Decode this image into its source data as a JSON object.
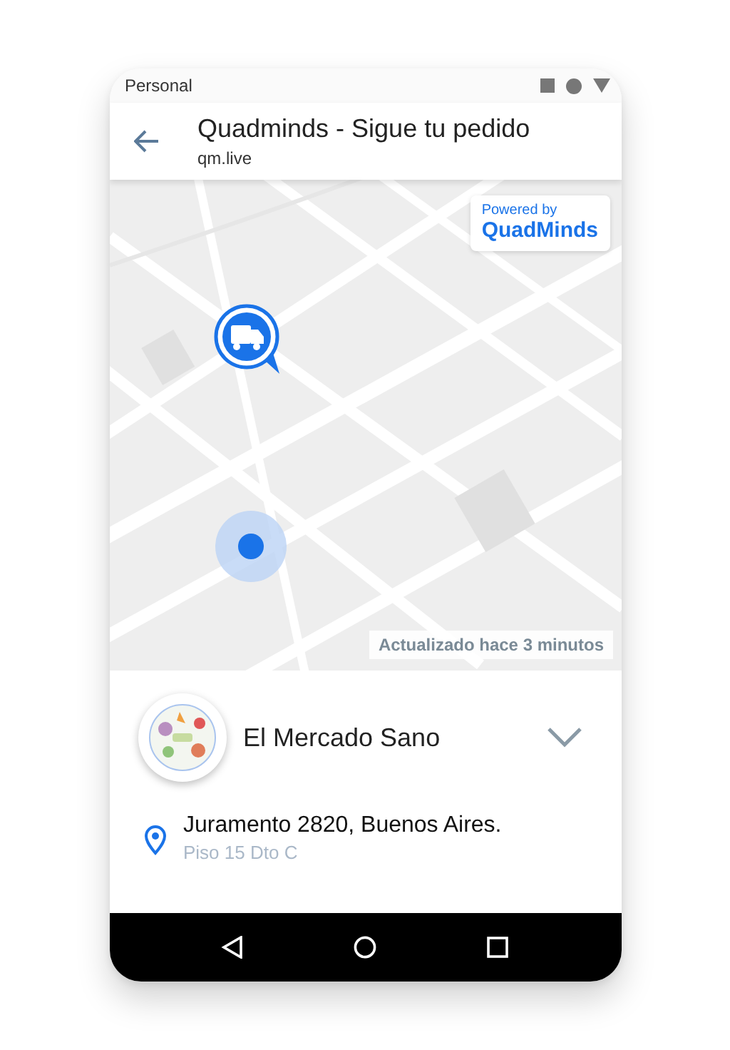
{
  "status_bar": {
    "carrier": "Personal"
  },
  "app_bar": {
    "title": "Quadminds - Sigue tu pedido",
    "url": "qm.live"
  },
  "map": {
    "kind": "picture",
    "badge": {
      "caption": "Powered by",
      "brand": "QuadMinds"
    },
    "updated": "Actualizado hace 3 minutos"
  },
  "store": {
    "name": "El Mercado Sano",
    "expanded": false
  },
  "address": {
    "line": "Juramento 2820, Buenos Aires.",
    "detail": "Piso 15 Dto C"
  }
}
